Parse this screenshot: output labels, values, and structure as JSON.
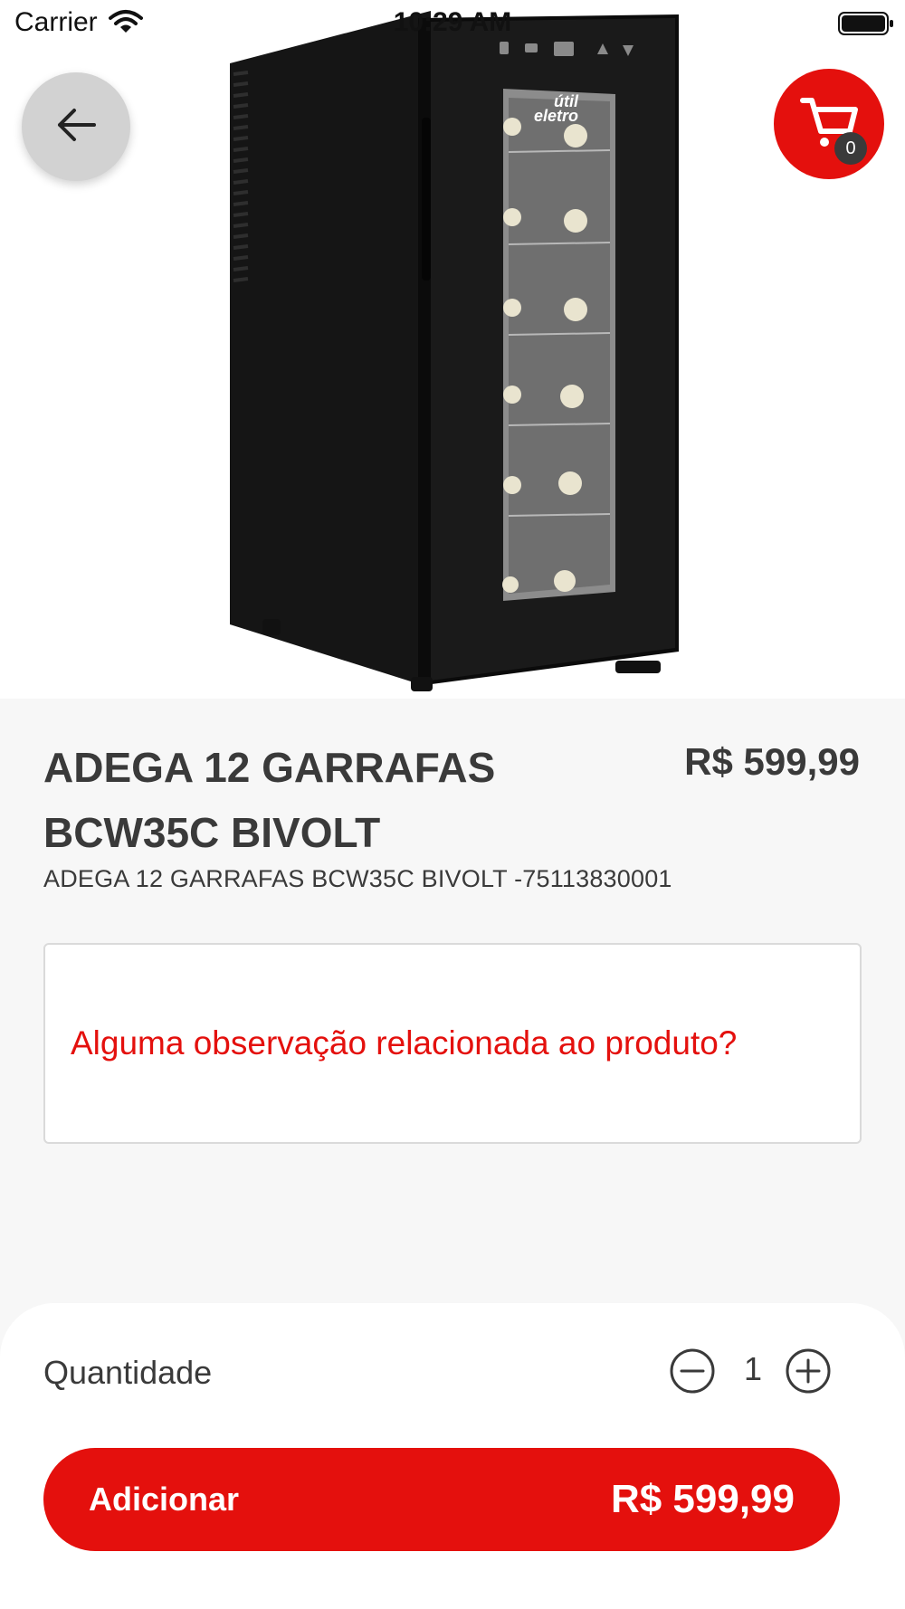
{
  "status_bar": {
    "carrier": "Carrier",
    "time": "10:29 AM"
  },
  "header": {
    "back_icon": "arrow-left-icon",
    "cart_icon": "shopping-cart-icon",
    "cart_count": "0"
  },
  "product": {
    "image_logo_text": "útil eletro",
    "title": "ADEGA 12 GARRAFAS BCW35C BIVOLT",
    "price": "R$ 599,99",
    "subtitle": "ADEGA 12 GARRAFAS BCW35C BIVOLT -75113830001"
  },
  "notes": {
    "prompt": "Alguma observação relacionada ao produto?"
  },
  "quantity": {
    "label": "Quantidade",
    "value": "1",
    "minus_icon": "minus-circle-icon",
    "plus_icon": "plus-circle-icon"
  },
  "add_button": {
    "label": "Adicionar",
    "price": "R$ 599,99"
  },
  "colors": {
    "accent": "#e4100d",
    "text": "#3a3a3a",
    "background": "#f7f7f7"
  }
}
